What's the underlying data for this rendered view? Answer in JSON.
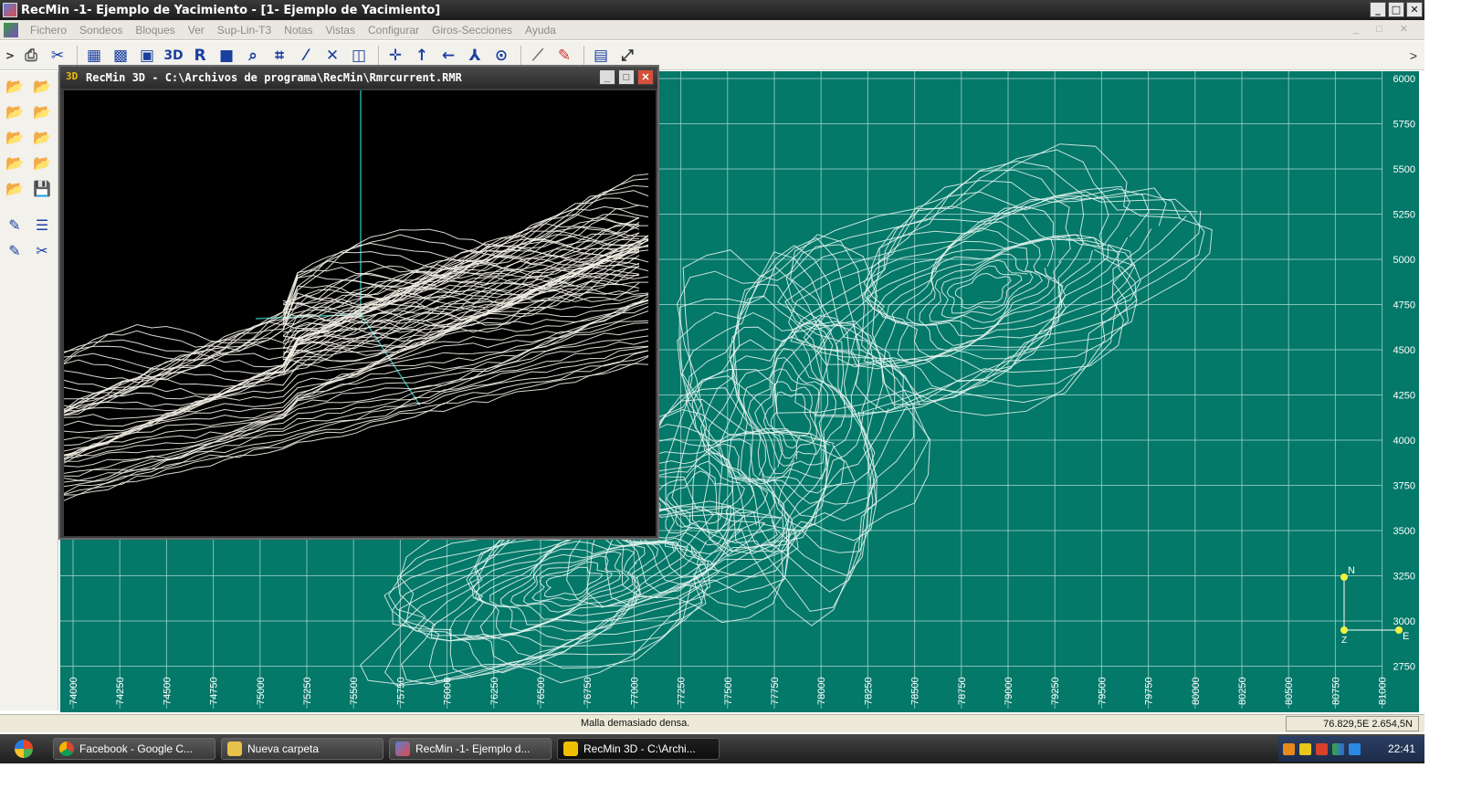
{
  "window": {
    "title": "RecMin -1- Ejemplo de Yacimiento - [1- Ejemplo de Yacimiento]",
    "controls": [
      "_",
      "□",
      "✕"
    ]
  },
  "menu": {
    "items": [
      "Fichero",
      "Sondeos",
      "Bloques",
      "Ver",
      "Sup-Lin-T3",
      "Notas",
      "Vistas",
      "Configurar",
      "Giros-Secciones",
      "Ayuda"
    ],
    "mdi_controls": "_ □ ✕"
  },
  "toolbar": {
    "buttons": [
      "print",
      "cut-lines",
      "map-view",
      "grid",
      "block-model",
      "3D",
      "R",
      "fill",
      "zoom",
      "snap",
      "draw-line",
      "delete",
      "window",
      "move",
      "north-arrow",
      "west-arrow",
      "axis",
      "target",
      "ruler",
      "pencil",
      "screen",
      "fullscreen"
    ],
    "more": ">"
  },
  "child_window": {
    "title": "RecMin 3D - C:\\Archivos de programa\\RecMin\\Rmrcurrent.RMR",
    "icon_label": "3D"
  },
  "map": {
    "background": "#047869",
    "grid_color": "#9fd3cb",
    "y_labels": [
      "6000",
      "5750",
      "5500",
      "5250",
      "5000",
      "4750",
      "4500",
      "4250",
      "4000",
      "3750",
      "3500",
      "3250",
      "3000",
      "2750"
    ],
    "x_labels": [
      "74000",
      "74250",
      "74500",
      "74750",
      "75000",
      "75250",
      "75500",
      "75750",
      "76000",
      "76250",
      "76500",
      "76750",
      "77000",
      "77250",
      "77500",
      "77750",
      "78000",
      "78250",
      "78500",
      "78750",
      "79000",
      "79250",
      "79500",
      "79750",
      "80000",
      "80250",
      "80500",
      "80750",
      "81000"
    ],
    "compass": {
      "north": "N",
      "east": "E",
      "z": "Z"
    }
  },
  "status": {
    "message": "Malla demasiado densa.",
    "coords": "76.829,5E 2.654,5N"
  },
  "taskbar": {
    "tasks": [
      {
        "label": "Facebook - Google C...",
        "icon": "chrome-icon"
      },
      {
        "label": "Nueva carpeta",
        "icon": "folder-icon"
      },
      {
        "label": "RecMin -1- Ejemplo d...",
        "icon": "recmin-icon"
      },
      {
        "label": "RecMin 3D - C:\\Archi...",
        "icon": "recmin3d-icon"
      }
    ],
    "clock": "22:41"
  }
}
